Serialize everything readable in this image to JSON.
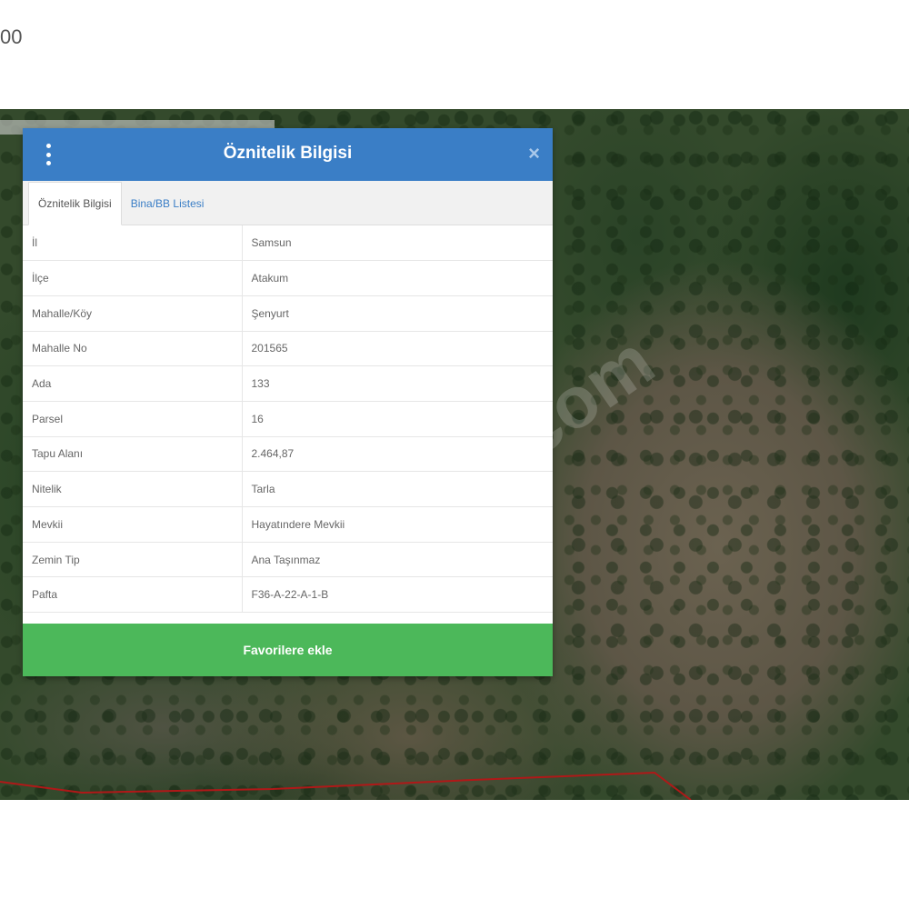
{
  "corner_text": "00",
  "map": {
    "watermark": "com"
  },
  "panel": {
    "title": "Öznitelik Bilgisi",
    "menu_icon": "vertical-dots-icon",
    "close_icon": "close-icon",
    "close_symbol": "×",
    "tabs": [
      {
        "label": "Öznitelik Bilgisi",
        "active": true
      },
      {
        "label": "Bina/BB Listesi",
        "active": false
      }
    ],
    "rows": [
      {
        "key": "İl",
        "value": "Samsun"
      },
      {
        "key": "İlçe",
        "value": "Atakum"
      },
      {
        "key": "Mahalle/Köy",
        "value": "Şenyurt"
      },
      {
        "key": "Mahalle No",
        "value": "201565"
      },
      {
        "key": "Ada",
        "value": "133"
      },
      {
        "key": "Parsel",
        "value": "16"
      },
      {
        "key": "Tapu Alanı",
        "value": "2.464,87"
      },
      {
        "key": "Nitelik",
        "value": "Tarla"
      },
      {
        "key": "Mevkii",
        "value": "Hayatındere Mevkii"
      },
      {
        "key": "Zemin Tip",
        "value": "Ana Taşınmaz"
      },
      {
        "key": "Pafta",
        "value": "F36-A-22-A-1-B"
      }
    ],
    "favorite_button": "Favorilere ekle"
  },
  "colors": {
    "header": "#3a7ec6",
    "button": "#4cb85a",
    "parcel_border": "#b01818"
  }
}
